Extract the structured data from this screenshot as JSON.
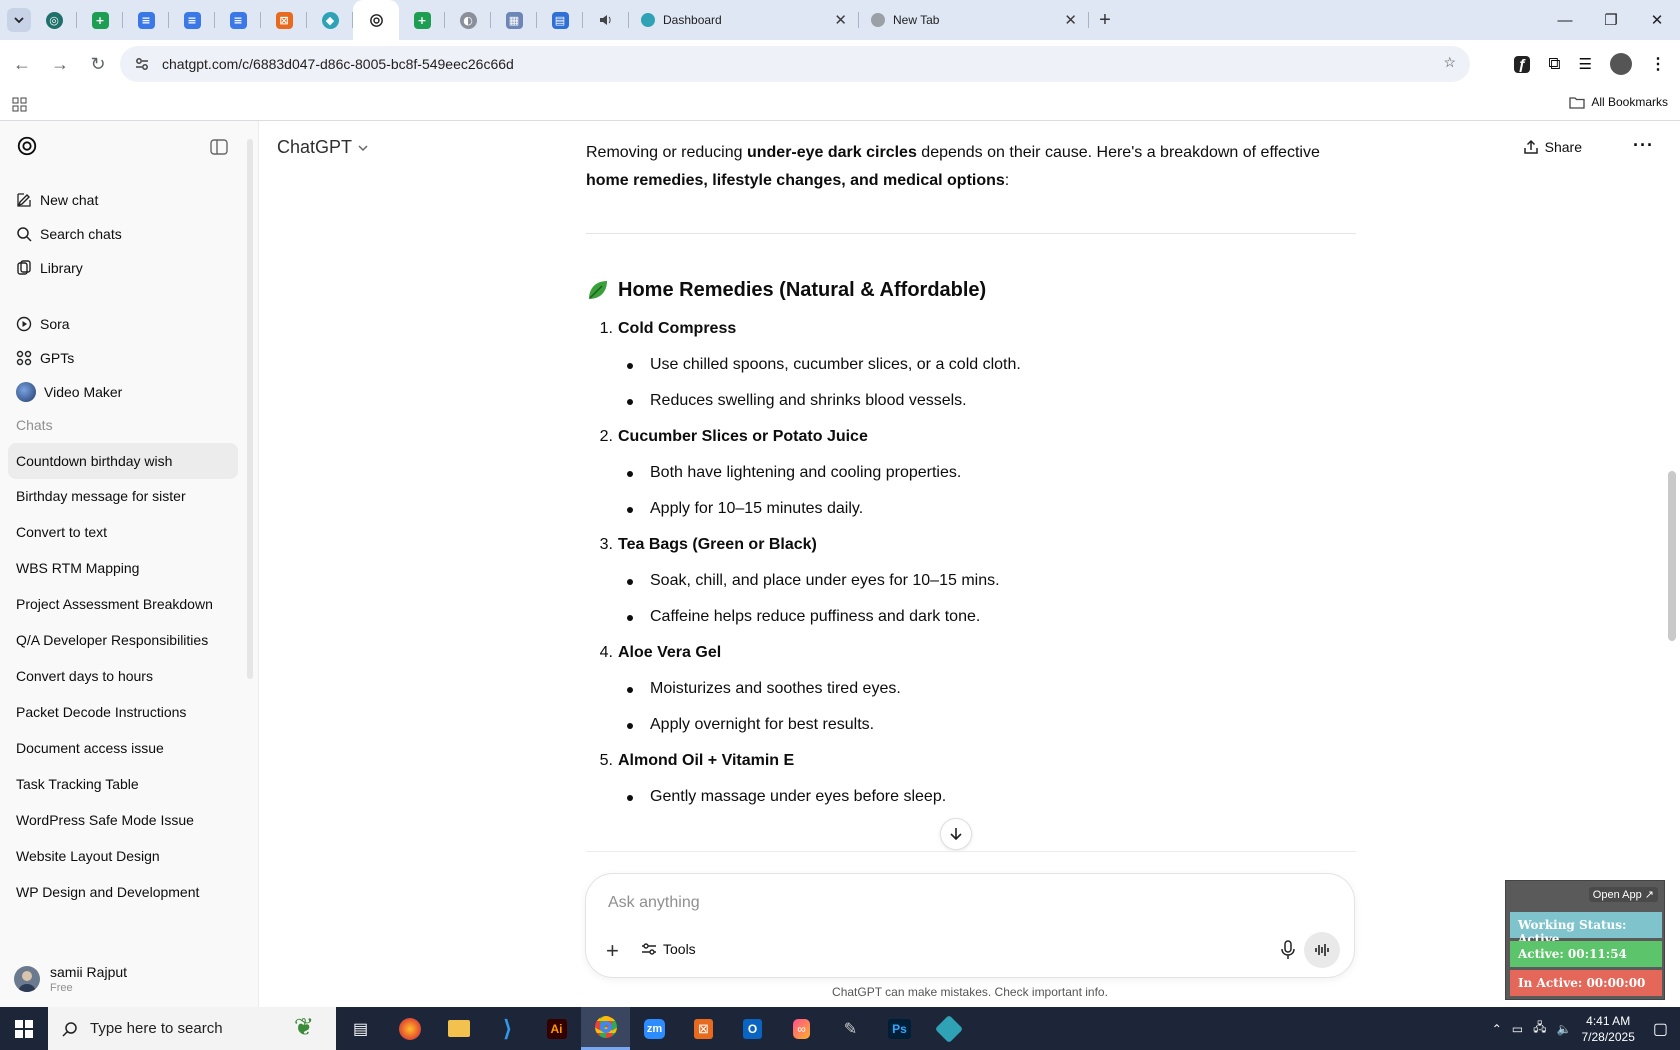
{
  "browser": {
    "tabs": [
      {
        "label": "Dashboard",
        "close": "✕"
      },
      {
        "label": "New Tab",
        "close": "✕"
      }
    ],
    "new_tab_symbol": "+",
    "url": "chatgpt.com/c/6883d047-d86c-8005-bc8f-549eec26c66d",
    "all_bookmarks": "All Bookmarks"
  },
  "sidebar": {
    "nav": [
      {
        "label": "New chat",
        "icon": "edit-icon"
      },
      {
        "label": "Search chats",
        "icon": "search-icon"
      },
      {
        "label": "Library",
        "icon": "library-icon"
      },
      {
        "label": "Sora",
        "icon": "play-circle-icon"
      },
      {
        "label": "GPTs",
        "icon": "grid-icon"
      },
      {
        "label": "Video Maker",
        "icon": "video-maker-avatar"
      }
    ],
    "chats_heading": "Chats",
    "chats": [
      "Countdown birthday wish",
      "Birthday message for sister",
      "Convert to text",
      "WBS RTM Mapping",
      "Project Assessment Breakdown",
      "Q/A Developer Responsibilities",
      "Convert days to hours",
      "Packet Decode Instructions",
      "Document access issue",
      "Task Tracking Table",
      "WordPress Safe Mode Issue",
      "Website Layout Design",
      "WP Design and Development"
    ],
    "user": {
      "name": "samii Rajput",
      "plan": "Free"
    }
  },
  "header": {
    "model": "ChatGPT",
    "share": "Share",
    "more": "···"
  },
  "message": {
    "intro": {
      "p1": "Removing or reducing ",
      "b1": "under-eye dark circles",
      "p2": " depends on their cause. Here's a breakdown of effective ",
      "b2": "home remedies, lifestyle changes, and medical options",
      "p3": ":"
    },
    "section_title": "Home Remedies (Natural & Affordable)",
    "items": [
      {
        "num": "1.",
        "title": "Cold Compress",
        "bullets": [
          "Use chilled spoons, cucumber slices, or a cold cloth.",
          "Reduces swelling and shrinks blood vessels."
        ]
      },
      {
        "num": "2.",
        "title": "Cucumber Slices or Potato Juice",
        "bullets": [
          "Both have lightening and cooling properties.",
          "Apply for 10–15 minutes daily."
        ]
      },
      {
        "num": "3.",
        "title": "Tea Bags (Green or Black)",
        "bullets": [
          "Soak, chill, and place under eyes for 10–15 mins.",
          "Caffeine helps reduce puffiness and dark tone."
        ]
      },
      {
        "num": "4.",
        "title": "Aloe Vera Gel",
        "bullets": [
          "Moisturizes and soothes tired eyes.",
          "Apply overnight for best results."
        ]
      },
      {
        "num": "5.",
        "title": "Almond Oil + Vitamin E",
        "bullets": [
          "Gently massage under eyes before sleep."
        ]
      }
    ]
  },
  "composer": {
    "placeholder": "Ask anything",
    "tools": "Tools",
    "disclaimer": "ChatGPT can make mistakes. Check important info."
  },
  "widget": {
    "open_app": "Open App ↗",
    "status": "Working Status: Active",
    "active": "Active: 00:11:54",
    "inactive": "In Active: 00:00:00",
    "colors": {
      "status": "#7fc4cc",
      "active": "#5cc46a",
      "inactive": "#e4685a"
    }
  },
  "taskbar": {
    "search_placeholder": "Type here to search",
    "time": "4:41 AM",
    "date": "7/28/2025"
  },
  "colors": {
    "accent": "#0d0d0d",
    "tabbar": "#dfe7f5",
    "taskbar": "#1c2638"
  }
}
